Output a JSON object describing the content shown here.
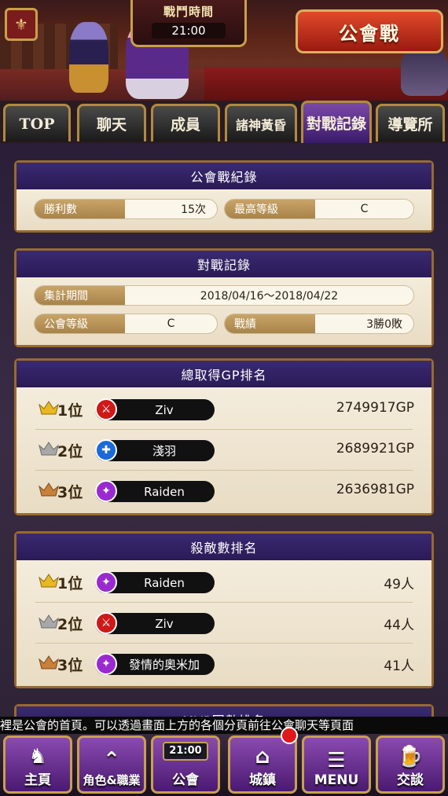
{
  "header": {
    "battle_time_label": "戰鬥時間",
    "battle_time_value": "21:00",
    "guild_war_button": "公會戰"
  },
  "tabs": [
    {
      "label": "TOP",
      "active": false
    },
    {
      "label": "聊天",
      "active": false
    },
    {
      "label": "成員",
      "active": false
    },
    {
      "label": "諸神黃昏",
      "active": false
    },
    {
      "label": "對戰記錄",
      "active": true
    },
    {
      "label": "導覽所",
      "active": false
    }
  ],
  "guild_war_record": {
    "title": "公會戰紀錄",
    "wins_label": "勝利數",
    "wins_value": "15次",
    "best_rank_label": "最高等級",
    "best_rank_value": "C"
  },
  "battle_record": {
    "title": "對戰記錄",
    "period_label": "集計期間",
    "period_value": "2018/04/16～2018/04/22",
    "guild_rank_label": "公會等級",
    "guild_rank_value": "C",
    "result_label": "戰績",
    "result_value": "3勝0敗"
  },
  "gp_ranking": {
    "title": "總取得GP排名",
    "rows": [
      {
        "rank": "1位",
        "name": "Ziv",
        "score": "2749917GP",
        "job_color": "#d01818",
        "crown_color": "#e8b820",
        "job_icon": "sword-icon"
      },
      {
        "rank": "2位",
        "name": "淺羽",
        "score": "2689921GP",
        "job_color": "#1a6ad8",
        "crown_color": "#a8a8a8",
        "job_icon": "cross-icon"
      },
      {
        "rank": "3位",
        "name": "Raiden",
        "score": "2636981GP",
        "job_color": "#9a2ad0",
        "crown_color": "#c8803a",
        "job_icon": "staff-icon"
      }
    ]
  },
  "kill_ranking": {
    "title": "殺敵數排名",
    "rows": [
      {
        "rank": "1位",
        "name": "Raiden",
        "score": "49人",
        "job_color": "#9a2ad0",
        "crown_color": "#e8b820",
        "job_icon": "staff-icon"
      },
      {
        "rank": "2位",
        "name": "Ziv",
        "score": "44人",
        "job_color": "#d01818",
        "crown_color": "#a8a8a8",
        "job_icon": "sword-icon"
      },
      {
        "rank": "3位",
        "name": "發情的奧米加",
        "score": "41人",
        "job_color": "#9a2ad0",
        "crown_color": "#c8803a",
        "job_icon": "staff-icon"
      }
    ]
  },
  "next_panel_title": "MVP回數排名",
  "ticker": "裡是公會的首頁。可以透過畫面上方的各個分頁前往公會聊天等頁面",
  "bottom_nav": [
    {
      "label": "主頁",
      "icon": "pegasus-icon"
    },
    {
      "label": "角色&職業",
      "icon": "hero-icon"
    },
    {
      "label": "公會",
      "icon": "guild-timer-icon",
      "time": "21:00"
    },
    {
      "label": "城鎮",
      "icon": "town-icon"
    },
    {
      "label": "MENU",
      "icon": "menu-lines-icon"
    },
    {
      "label": "交談",
      "icon": "beer-icon"
    }
  ]
}
